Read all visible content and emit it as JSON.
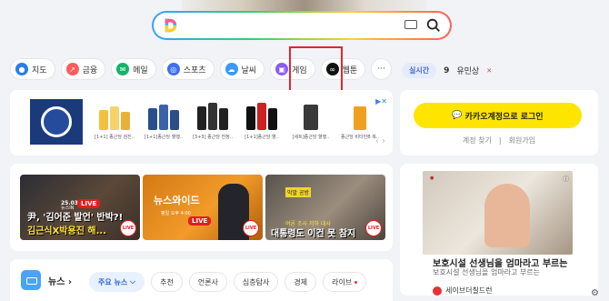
{
  "search": {
    "placeholder": ""
  },
  "shortcuts": [
    {
      "label": "지도",
      "icon": "map-pin-icon",
      "color": "#2b7de9"
    },
    {
      "label": "금융",
      "icon": "finance-chart-icon",
      "color": "#ff5b5b"
    },
    {
      "label": "메일",
      "icon": "mail-icon",
      "color": "#16b36a"
    },
    {
      "label": "스포츠",
      "icon": "sports-icon",
      "color": "#3f6ef0"
    },
    {
      "label": "날씨",
      "icon": "weather-cloud-icon",
      "color": "#3a9af6"
    },
    {
      "label": "게임",
      "icon": "game-controller-icon",
      "color": "#8b5cf6"
    },
    {
      "label": "웹툰",
      "icon": "webtoon-icon",
      "color": "#111111"
    }
  ],
  "more_label": "···",
  "realtime": {
    "badge": "실시간",
    "rank": "9",
    "keyword": "유민상"
  },
  "ad": {
    "products": [
      "[1+1] 종근당 검진..",
      "[1+1]종근당 혈행..",
      "[3+3] 종근당 전정..",
      "[1+1]종근당 혈..",
      "[세트]종근당 혈행..",
      "종근당 비타민B 복.."
    ],
    "ad_mark": "Ad"
  },
  "login": {
    "button": "카카오계정으로 로그인",
    "find": "계정 찾기",
    "signup": "회원가입"
  },
  "news_thumbs": [
    {
      "date": "25.03.16(일)",
      "channel": "뉴스IN",
      "live": "LIVE",
      "line1": "尹, '김어준 발언' 반박?!",
      "line2": "김근식X박용진 해..."
    },
    {
      "title": "뉴스와이드",
      "time": "평일 오후 4:00",
      "live": "LIVE"
    },
    {
      "tag": "막말 공방",
      "line1": "여론 조사 저하 대사",
      "line2": "대통령도 이건 못 참지"
    }
  ],
  "live_badge": "LIVE",
  "side_news": {
    "title": "보호시설 선생님을 엄마라고 부르는",
    "sub": "보호시설 선생님을 엄마라고 부르는",
    "source": "세이브더칠드런"
  },
  "news": {
    "label": "뉴스",
    "tabs": [
      "주요 뉴스",
      "추천",
      "언론사",
      "심층탐사",
      "경제",
      "라이브"
    ]
  }
}
